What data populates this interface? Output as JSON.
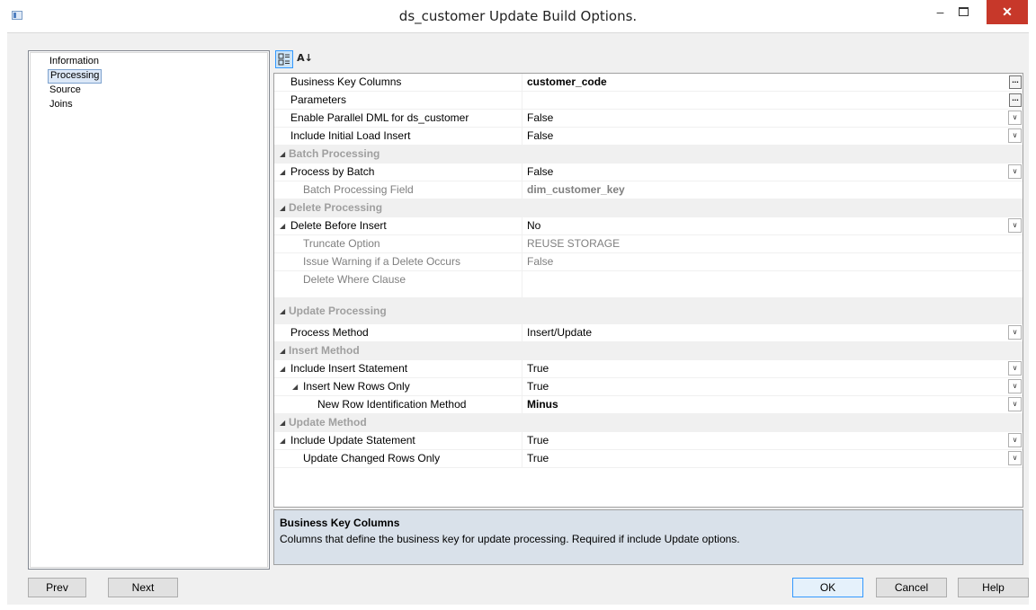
{
  "window": {
    "title": "ds_customer Update Build Options.",
    "minimize_glyph": "–",
    "close_glyph": "✕"
  },
  "nav": {
    "items": [
      {
        "label": "Information",
        "selected": false
      },
      {
        "label": "Processing",
        "selected": true
      },
      {
        "label": "Source",
        "selected": false
      },
      {
        "label": "Joins",
        "selected": false
      }
    ]
  },
  "toolbar": {
    "categorized_icon": "categorized-icon",
    "alphabetical_icon": "sort-alpha-icon",
    "alphabetical_glyph": "A↓"
  },
  "grid": {
    "rows": [
      {
        "label": "Business Key Columns",
        "value": "customer_code",
        "value_bold": true,
        "editor": "ellipsis"
      },
      {
        "label": "Parameters",
        "value": "",
        "editor": "ellipsis"
      },
      {
        "label": "Enable Parallel DML for ds_customer",
        "value": "False",
        "editor": "dropdown"
      },
      {
        "label": "Include Initial Load Insert",
        "value": "False",
        "editor": "dropdown"
      },
      {
        "category": "Batch Processing"
      },
      {
        "label": "Process by Batch",
        "value": "False",
        "editor": "dropdown",
        "expander": true
      },
      {
        "label": "Batch Processing Field",
        "value": "dim_customer_key",
        "value_bold": true,
        "sub": true,
        "disabled": true
      },
      {
        "category": "Delete Processing"
      },
      {
        "label": "Delete Before Insert",
        "value": "No",
        "editor": "dropdown",
        "expander": true
      },
      {
        "label": "Truncate Option",
        "value": "REUSE STORAGE",
        "sub": true,
        "disabled": true
      },
      {
        "label": "Issue Warning if a Delete Occurs",
        "value": "False",
        "sub": true,
        "disabled": true
      },
      {
        "label": "Delete Where Clause",
        "value": "",
        "sub": true,
        "disabled": true,
        "tall": true
      },
      {
        "category": "Update Processing",
        "tall": true
      },
      {
        "label": "Process Method",
        "value": "Insert/Update",
        "editor": "dropdown"
      },
      {
        "category": "Insert Method"
      },
      {
        "label": "Include Insert Statement",
        "value": "True",
        "editor": "dropdown",
        "expander": true
      },
      {
        "label": "Insert New Rows Only",
        "value": "True",
        "editor": "dropdown",
        "expander": true,
        "sub": true
      },
      {
        "label": "New Row Identification Method",
        "value": "Minus",
        "value_bold": true,
        "editor": "dropdown",
        "deep": true
      },
      {
        "category": "Update Method"
      },
      {
        "label": "Include Update Statement",
        "value": "True",
        "editor": "dropdown",
        "expander": true
      },
      {
        "label": "Update Changed Rows Only",
        "value": "True",
        "editor": "dropdown",
        "sub": true
      }
    ],
    "expander_glyph": "◢",
    "dropdown_glyph": "∨",
    "ellipsis_glyph": "..."
  },
  "description": {
    "title": "Business Key Columns",
    "text": "Columns that define the business key for update processing. Required if include Update options."
  },
  "buttons": {
    "prev": "Prev",
    "next": "Next",
    "ok": "OK",
    "cancel": "Cancel",
    "help": "Help"
  },
  "colors": {
    "accent": "#3399ff",
    "close": "#c7382a",
    "category_text": "#9f9f9f",
    "description_bg": "#d9e1ea"
  }
}
